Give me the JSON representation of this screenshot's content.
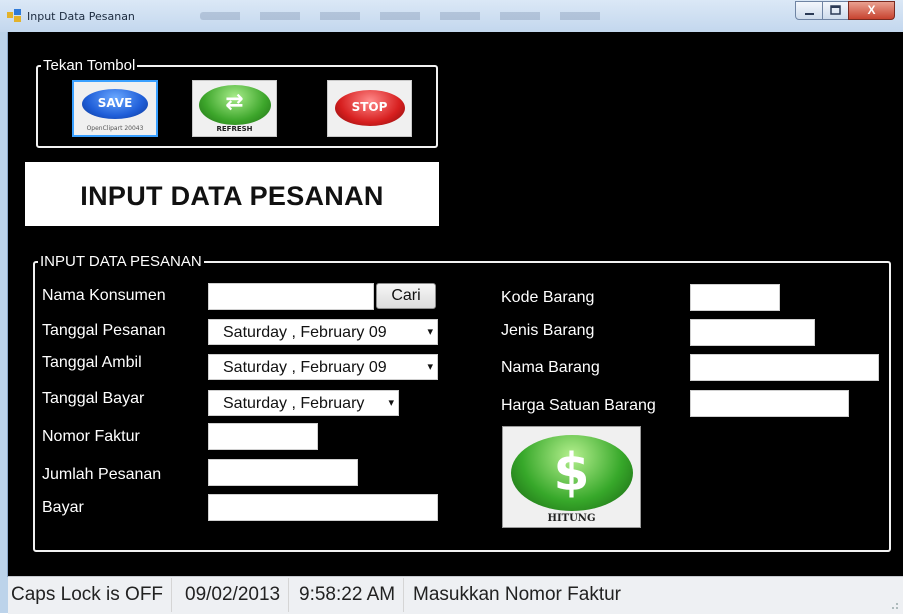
{
  "window": {
    "title": "Input Data Pesanan",
    "min_icon": "minimize-icon",
    "max_icon": "maximize-icon",
    "close_icon": "close-icon",
    "close_glyph": "X"
  },
  "toolbar_group": {
    "legend": "Tekan Tombol",
    "buttons": [
      {
        "name": "save",
        "label": "SAVE",
        "caption": "OpenClipart 20043",
        "color": "#1f5ed8"
      },
      {
        "name": "refresh",
        "label": "⇄",
        "caption": "REFRESH",
        "color": "#3da62b"
      },
      {
        "name": "stop",
        "label": "STOP",
        "caption": "",
        "color": "#d71f1f"
      }
    ]
  },
  "header_panel": {
    "title": "INPUT DATA PESANAN"
  },
  "form_group": {
    "legend": "INPUT DATA PESANAN",
    "labels": {
      "nama_konsumen": "Nama Konsumen",
      "tanggal_pesanan": "Tanggal Pesanan",
      "tanggal_ambil": "Tanggal Ambil",
      "tanggal_bayar": "Tanggal Bayar",
      "nomor_faktur": "Nomor Faktur",
      "jumlah_pesanan": "Jumlah Pesanan",
      "bayar": "Bayar",
      "kode_barang": "Kode Barang",
      "jenis_barang": "Jenis Barang",
      "nama_barang": "Nama Barang",
      "harga_satuan": "Harga Satuan Barang"
    },
    "values": {
      "nama_konsumen": "",
      "nomor_faktur": "",
      "jumlah_pesanan": "",
      "bayar": "",
      "kode_barang": "",
      "jenis_barang": "",
      "nama_barang": "",
      "harga_satuan": ""
    },
    "cari_label": "Cari",
    "dates": {
      "tanggal_pesanan": "Saturday  ,  February  09",
      "tanggal_ambil": "Saturday  ,  February  09",
      "tanggal_bayar": "Saturday  ,  February"
    },
    "dropdown_arrow": "▾",
    "hitung": {
      "symbol": "$",
      "label": "HITUNG",
      "color": "#37a82a"
    }
  },
  "statusbar": {
    "caps": "Caps Lock is OFF",
    "date": "09/02/2013",
    "time": "9:58:22 AM",
    "message": "Masukkan Nomor Faktur"
  },
  "colors": {
    "client_bg": "#000000",
    "label_text": "#ffffff",
    "titlebar": "#c3d7ee"
  }
}
